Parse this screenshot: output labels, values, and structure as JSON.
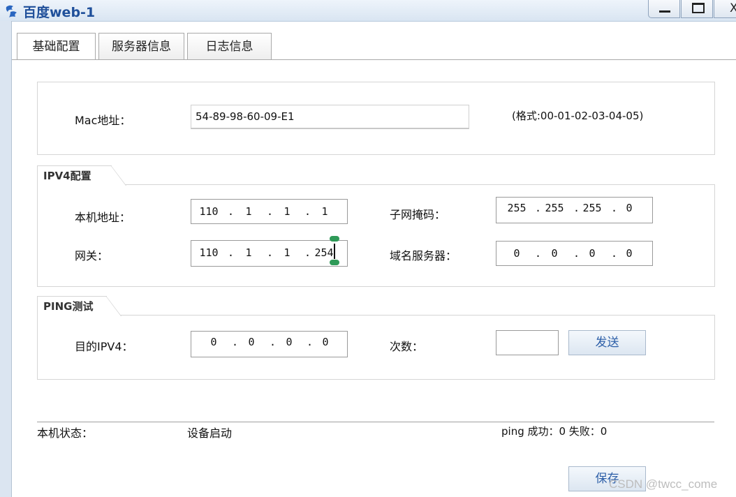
{
  "window": {
    "title": "百度web-1",
    "icons": [
      "minimize-icon",
      "maximize-icon",
      "close-icon"
    ],
    "close_glyph": "X"
  },
  "tabs": [
    {
      "label": "基础配置",
      "active": true
    },
    {
      "label": "服务器信息",
      "active": false
    },
    {
      "label": "日志信息",
      "active": false
    }
  ],
  "mac": {
    "label": "Mac地址：",
    "value": "54-89-98-60-09-E1",
    "hint": "(格式:00-01-02-03-04-05)"
  },
  "ipv4": {
    "legend": "IPV4配置",
    "local_address": {
      "label": "本机地址：",
      "octets": [
        "110",
        "1",
        "1",
        "1"
      ]
    },
    "subnet_mask": {
      "label": "子网掩码：",
      "octets": [
        "255",
        "255",
        "255",
        "0"
      ]
    },
    "gateway": {
      "label": "网关：",
      "octets": [
        "110",
        "1",
        "1",
        "254"
      ]
    },
    "dns": {
      "label": "域名服务器：",
      "octets": [
        "0",
        "0",
        "0",
        "0"
      ]
    }
  },
  "ping": {
    "legend": "PING测试",
    "dest_label": "目的IPV4：",
    "dest_octets": [
      "0",
      "0",
      "0",
      "0"
    ],
    "count_label": "次数：",
    "count_value": "",
    "send_label": "发送"
  },
  "status": {
    "label": "本机状态：",
    "value": "设备启动",
    "ping_result": "ping 成功：0 失败：0"
  },
  "save_label": "保存",
  "watermark": "CSDN @twcc_come",
  "colors": {
    "accent": "#2d5fa8",
    "title": "#1f4f9a",
    "frame": "#dbe5f1"
  }
}
